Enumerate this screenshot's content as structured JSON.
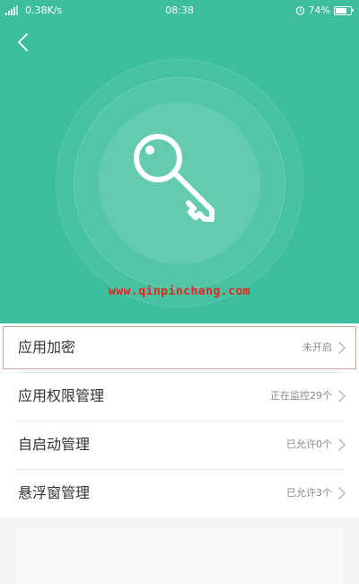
{
  "status_bar": {
    "speed": "0.38K/s",
    "time": "08:38",
    "battery": "74%",
    "battery_level": 0.74
  },
  "colors": {
    "hero_bg": "#3dbf9f",
    "watermark": "#e8251b",
    "highlight_border": "#d6a4a0"
  },
  "hero": {
    "icon": "key-icon",
    "watermark": "www.qinpinchang.com"
  },
  "menu": {
    "items": [
      {
        "label": "应用加密",
        "status": "未开启",
        "highlighted": true
      },
      {
        "label": "应用权限管理",
        "status": "正在监控29个",
        "highlighted": false
      },
      {
        "label": "自启动管理",
        "status": "已允许0个",
        "highlighted": false
      },
      {
        "label": "悬浮窗管理",
        "status": "已允许3个",
        "highlighted": false
      }
    ]
  }
}
